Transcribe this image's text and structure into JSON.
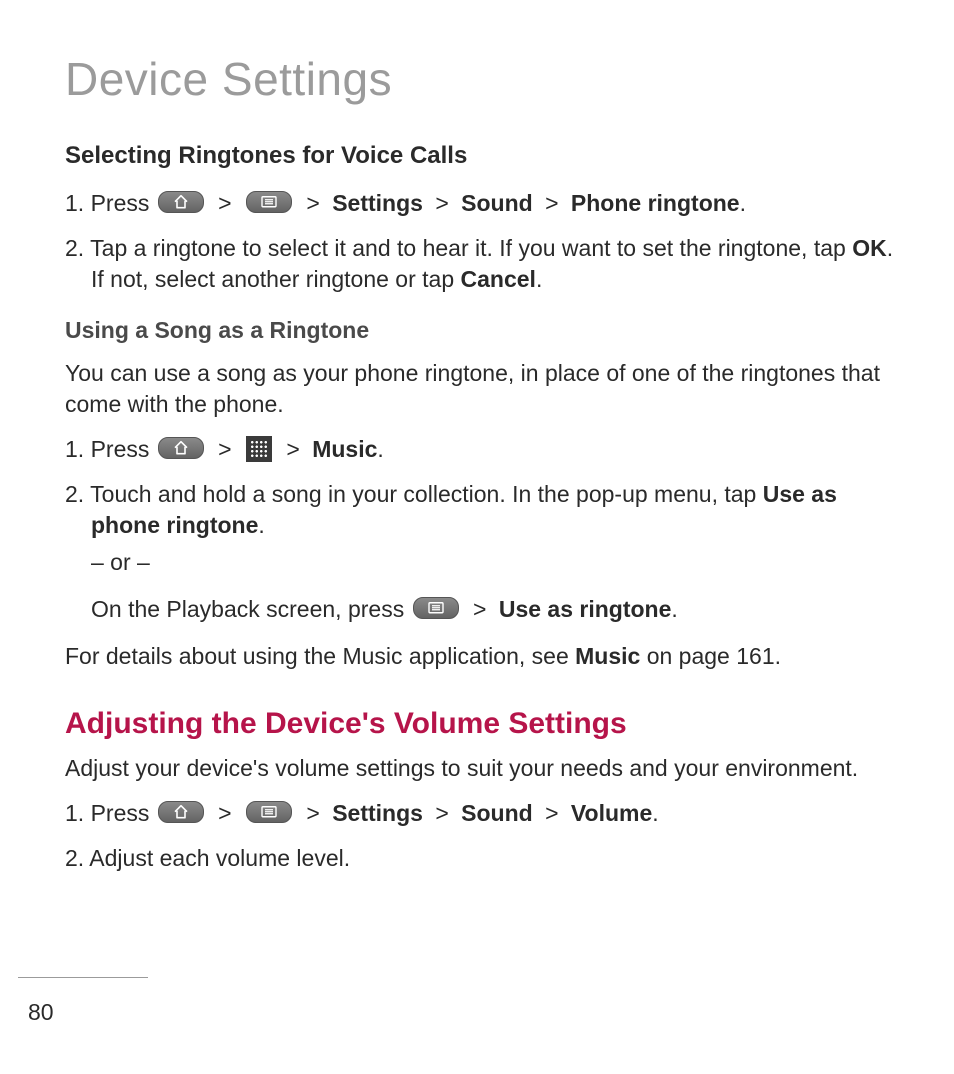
{
  "page": {
    "number": "80",
    "chapter_title": "Device Settings"
  },
  "s1": {
    "title": "Selecting Ringtones for Voice Calls",
    "step1_a": "1. Press ",
    "step1_b": "Settings",
    "step1_c": "Sound",
    "step1_d": "Phone ringtone",
    "step1_e": ".",
    "step2_a": "2. Tap a ringtone to select it and to hear it. If you want to set the ringtone, tap ",
    "step2_b": "OK",
    "step2_c": ". If not, select another ringtone or tap ",
    "step2_d": "Cancel",
    "step2_e": "."
  },
  "s2": {
    "title": "Using a Song as a Ringtone",
    "intro": "You can use a song as your phone ringtone, in place of one of the ringtones that come with the phone.",
    "step1_a": "1.  Press ",
    "step1_b": "Music",
    "step1_c": ".",
    "step2_a": "2. Touch and hold a song in your collection. In the pop-up menu, tap ",
    "step2_b": "Use as phone ringtone",
    "step2_c": ".",
    "or": "– or –",
    "alt_a": "On the Playback screen, press ",
    "alt_b": "Use as ringtone",
    "alt_c": ".",
    "closing_a": "For details about using the Music application, see ",
    "closing_b": "Music",
    "closing_c": " on page 161."
  },
  "s3": {
    "title": "Adjusting the Device's Volume Settings",
    "intro": "Adjust your device's volume settings to suit your needs and your environment.",
    "step1_a": "1. Press ",
    "step1_b": "Settings",
    "step1_c": "Sound",
    "step1_d": "Volume",
    "step1_e": ".",
    "step2": "2. Adjust each volume level."
  },
  "glyph": {
    "gt": ">"
  }
}
